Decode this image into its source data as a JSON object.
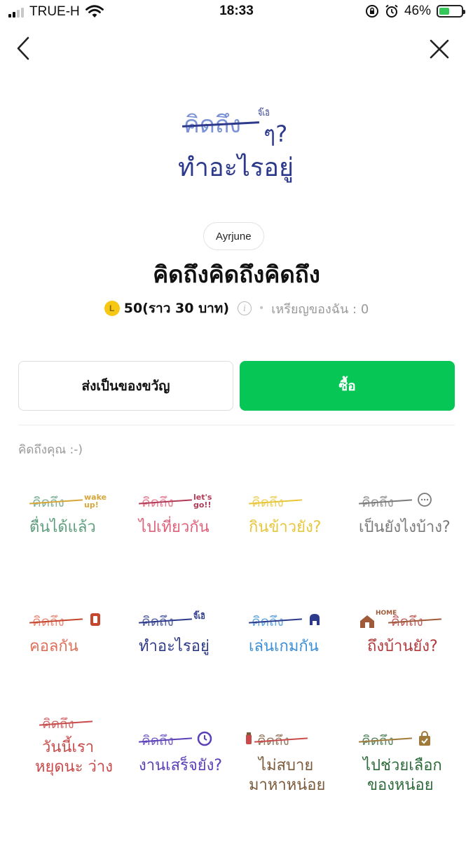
{
  "status_bar": {
    "carrier": "TRUE-H",
    "time": "18:33",
    "battery_percent": "46%",
    "battery_level": 0.46
  },
  "nav": {
    "back_icon": "chevron-left-icon",
    "close_icon": "close-icon"
  },
  "hero": {
    "line1": "คิดถึง",
    "side_text": "จิ๊เอิ",
    "mark": "ๆ?",
    "line2": "ทำอะไรอยู่"
  },
  "pack": {
    "author": "Ayrjune",
    "title": "คิดถึงคิดถึงคิดถึง",
    "coin_symbol": "L",
    "price": "50",
    "price_note": "(ราว 30 บาท)",
    "info_icon": "info-icon",
    "separator": "•",
    "balance": "เหรียญของฉัน : 0",
    "description": "คิดถึงคุณ :-)"
  },
  "actions": {
    "gift_label": "ส่งเป็นของขวัญ",
    "buy_label": "ซื้อ"
  },
  "colors": {
    "buy_green": "#06c755",
    "coin_yellow": "#f6c814",
    "hero_blue": "#2d3a8c"
  },
  "stickers": [
    {
      "top": "คิดถึง",
      "side": "wake up!",
      "main": "ตื่นได้แล้ว",
      "main2": "",
      "color": "#5e9e7e",
      "accent": "#d7a63a"
    },
    {
      "top": "คิดถึง",
      "side": "let's go!!",
      "main": "ไปเที่ยวกัน",
      "main2": "",
      "color": "#e0617a",
      "accent": "#b23a56"
    },
    {
      "top": "คิดถึง",
      "side": "",
      "main": "กินข้าวยัง?",
      "main2": "",
      "color": "#e8c63a",
      "accent": "#e8c63a"
    },
    {
      "top": "คิดถึง",
      "side": "",
      "main": "เป็นยังไงบ้าง?",
      "main2": "",
      "color": "#7a7a7a",
      "accent": "#7a7a7a"
    },
    {
      "top": "คิดถึง",
      "side": "",
      "main": "คอลกัน",
      "main2": "",
      "color": "#e0705a",
      "accent": "#c5452d"
    },
    {
      "top": "คิดถึง",
      "side": "จิ๊เอิ",
      "main": "ทำอะไรอยู่",
      "main2": "",
      "color": "#2d3a8c",
      "accent": "#2d3a8c"
    },
    {
      "top": "คิดถึง",
      "side": "",
      "main": "เล่นเกมกัน",
      "main2": "",
      "color": "#3b8fd8",
      "accent": "#2d3a8c"
    },
    {
      "top": "คิดถึง",
      "side": "HOME",
      "main": "ถึงบ้านยัง?",
      "main2": "",
      "color": "#b23a3a",
      "accent": "#a05a3a"
    },
    {
      "top": "คิดถึง",
      "side": "",
      "main": "วันนี้เรา",
      "main2": "หยุดนะ ว่าง",
      "color": "#c94a4a",
      "accent": "#c94a4a"
    },
    {
      "top": "คิดถึง",
      "side": "",
      "main": "งานเสร็จยัง?",
      "main2": "",
      "color": "#5a3fb8",
      "accent": "#5a3fb8"
    },
    {
      "top": "คิดถึง",
      "side": "",
      "main": "ไม่สบาย",
      "main2": "มาหาหน่อย",
      "color": "#7a5a3a",
      "accent": "#c94a4a"
    },
    {
      "top": "คิดถึง",
      "side": "",
      "main": "ไปช่วยเลือก",
      "main2": "ของหน่อย",
      "color": "#2e6b3a",
      "accent": "#a07a3a"
    }
  ]
}
